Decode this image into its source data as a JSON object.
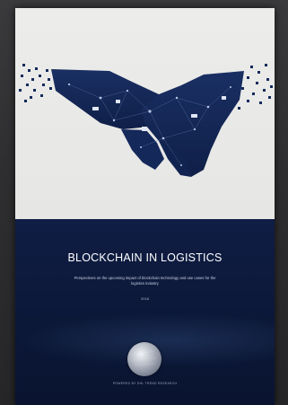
{
  "cover": {
    "title": "BLOCKCHAIN IN LOGISTICS",
    "subtitle": "Perspectives on the upcoming impact of blockchain technology and use cases for the logistics industry",
    "year": "2018",
    "brand": "POWERED BY DHL TREND RESEARCH"
  },
  "colors": {
    "background": "#2b2b2d",
    "cover_top": "#ececea",
    "cover_bottom": "#0d1a3a",
    "hand": "#132554"
  },
  "icons": [
    "handshake-icon",
    "seal-icon"
  ]
}
